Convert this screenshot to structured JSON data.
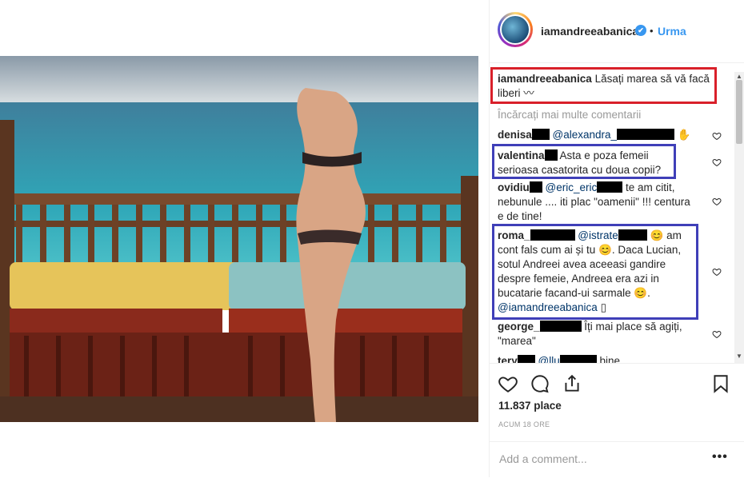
{
  "post": {
    "username": "iamandreeabanica",
    "follow_label": "Urma",
    "dot": "•",
    "verified_mark": "✔"
  },
  "caption": {
    "username": "iamandreeabanica",
    "text": "Lăsați marea să vă facă liberi"
  },
  "load_more_label": "Încărcați mai multe comentarii",
  "comments": [
    {
      "user": "denisa",
      "mention": "@alexandra_",
      "text": ""
    },
    {
      "user": "valentina",
      "text": "Asta e poza femeii serioasa casatorita cu doua copii?"
    },
    {
      "user": "ovidiu",
      "mention": "@eric_eric",
      "text": "te am citit, nebunule .... iti plac \"oamenii\" !!! centura e de tine!"
    },
    {
      "user": "roma_",
      "mention": "@istrate",
      "text1": "😊 am cont fals cum ai și tu 😊. Daca Lucian, sotul Andreei avea aceeasi gandire despre femeie, Andreea era azi in bucatarie facand-ui sarmale 😊.",
      "mention2": "@iamandreeabanica",
      "tail": "▯"
    },
    {
      "user": "george_",
      "text": "Îți mai place să agiți, \"marea\""
    },
    {
      "user": "tery",
      "mention": "@llu",
      "text": "bine"
    }
  ],
  "likes": "11.837 place",
  "timestamp": "ACUM 18 ORE",
  "add_comment_placeholder": "Add a comment...",
  "more_options": "•••",
  "colors": {
    "accent": "#3897f0",
    "highlight_red": "#d9202a",
    "highlight_blue": "#3f3fb8"
  }
}
